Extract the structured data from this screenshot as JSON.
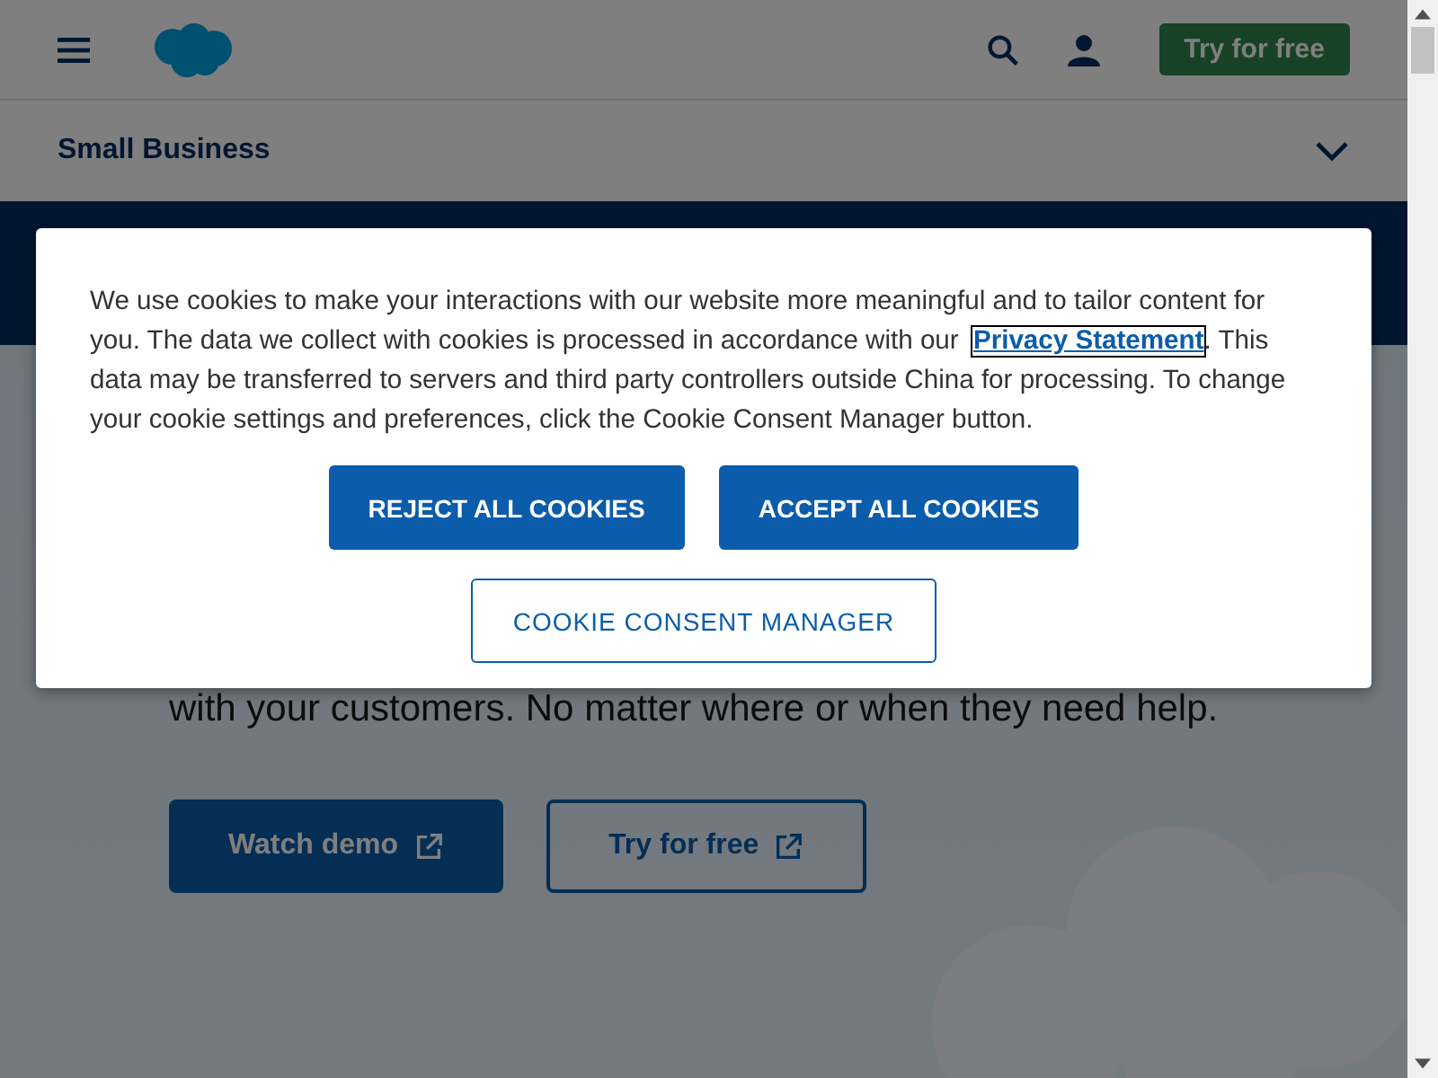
{
  "header": {
    "try_button": "Try for free"
  },
  "subnav": {
    "title": "Small Business",
    "expanded": false
  },
  "hero": {
    "text": "with your customers. No matter where or when they need help.",
    "buttons": [
      {
        "label": "Watch demo",
        "kind": "primary"
      },
      {
        "label": "Try for free",
        "kind": "outline"
      }
    ]
  },
  "cookie_dialog": {
    "text_before": "We use cookies to make your interactions with our website more meaningful and to tailor content for you. The data we collect with cookies is processed in accordance with our ",
    "link": "Privacy Statement",
    "text_after": ". This data may be transferred to servers and third party controllers outside China for processing. To change your cookie settings and preferences, click the Cookie Consent Manager button.",
    "buttons": [
      {
        "label": "REJECT ALL COOKIES",
        "kind": "primary"
      },
      {
        "label": "ACCEPT ALL COOKIES",
        "kind": "primary"
      },
      {
        "label": "COOKIE CONSENT MANAGER",
        "kind": "outline"
      }
    ]
  }
}
